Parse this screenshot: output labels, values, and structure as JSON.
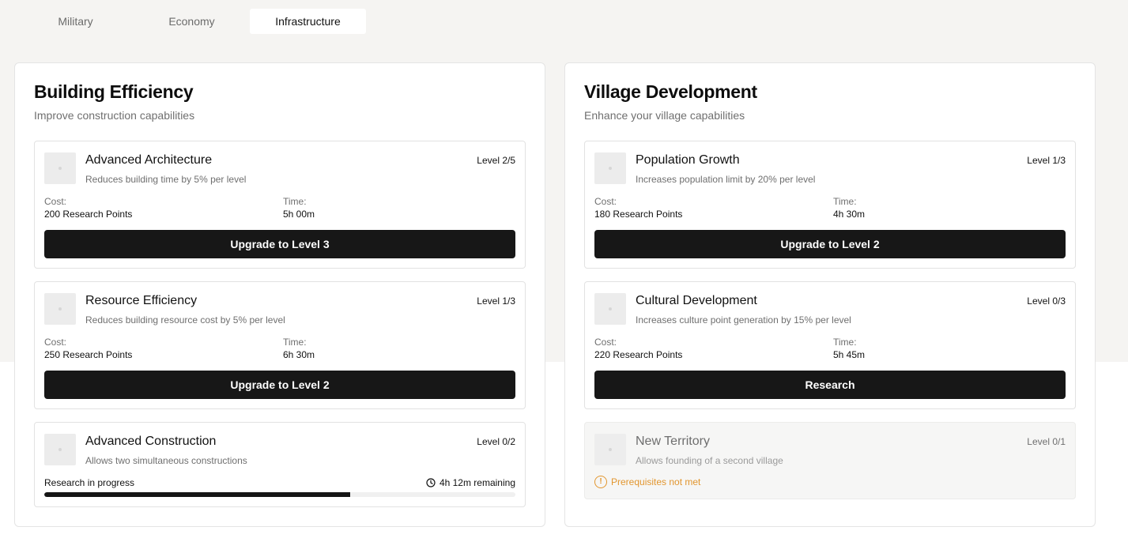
{
  "tabs": [
    {
      "label": "Military",
      "active": false
    },
    {
      "label": "Economy",
      "active": false
    },
    {
      "label": "Infrastructure",
      "active": true
    }
  ],
  "panels": {
    "left": {
      "title": "Building Efficiency",
      "subtitle": "Improve construction capabilities",
      "cards": [
        {
          "name": "Advanced Architecture",
          "description": "Reduces building time by 5% per level",
          "level": "Level 2/5",
          "cost_label": "Cost:",
          "cost": "200 Research Points",
          "time_label": "Time:",
          "time": "5h 00m",
          "button": "Upgrade to Level 3"
        },
        {
          "name": "Resource Efficiency",
          "description": "Reduces building resource cost by 5% per level",
          "level": "Level 1/3",
          "cost_label": "Cost:",
          "cost": "250 Research Points",
          "time_label": "Time:",
          "time": "6h 30m",
          "button": "Upgrade to Level 2"
        },
        {
          "name": "Advanced Construction",
          "description": "Allows two simultaneous constructions",
          "level": "Level 0/2",
          "progress_label": "Research in progress",
          "remaining": "4h 12m remaining",
          "progress_fraction": 0.65
        }
      ]
    },
    "right": {
      "title": "Village Development",
      "subtitle": "Enhance your village capabilities",
      "cards": [
        {
          "name": "Population Growth",
          "description": "Increases population limit by 20% per level",
          "level": "Level 1/3",
          "cost_label": "Cost:",
          "cost": "180 Research Points",
          "time_label": "Time:",
          "time": "4h 30m",
          "button": "Upgrade to Level 2"
        },
        {
          "name": "Cultural Development",
          "description": "Increases culture point generation by 15% per level",
          "level": "Level 0/3",
          "cost_label": "Cost:",
          "cost": "220 Research Points",
          "time_label": "Time:",
          "time": "5h 45m",
          "button": "Research"
        },
        {
          "name": "New Territory",
          "description": "Allows founding of a second village",
          "level": "Level 0/1",
          "prerequisite": "Prerequisites not met",
          "locked": true
        }
      ]
    }
  },
  "colors": {
    "accent": "#171717",
    "warning": "#e2962f",
    "background": "#f5f4f2"
  },
  "icons": {
    "clock": "clock-icon",
    "warning": "alert-circle-icon"
  }
}
